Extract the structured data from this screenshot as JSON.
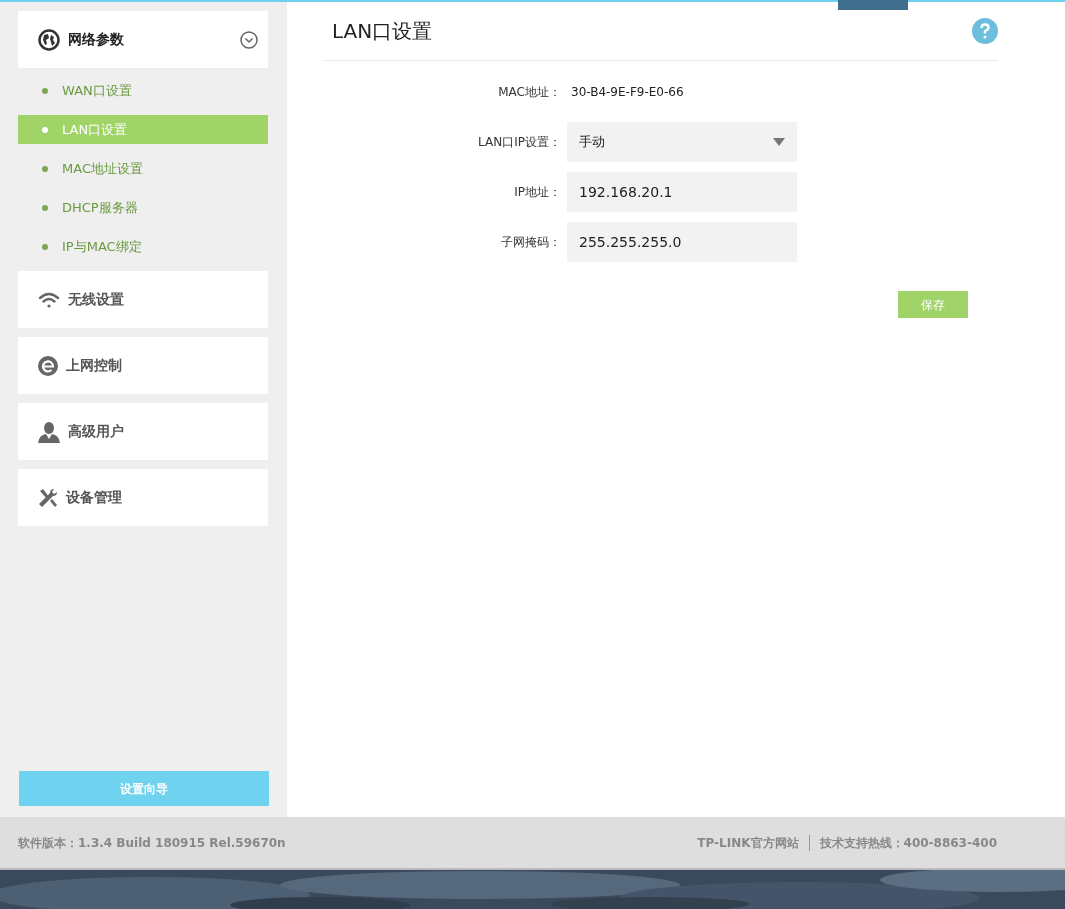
{
  "sidebar": {
    "groups": [
      {
        "label": "网络参数",
        "expanded": true,
        "items": [
          {
            "label": "WAN口设置",
            "selected": false
          },
          {
            "label": "LAN口设置",
            "selected": true
          },
          {
            "label": "MAC地址设置",
            "selected": false
          },
          {
            "label": "DHCP服务器",
            "selected": false
          },
          {
            "label": "IP与MAC绑定",
            "selected": false
          }
        ]
      },
      {
        "label": "无线设置",
        "expanded": false
      },
      {
        "label": "上网控制",
        "expanded": false
      },
      {
        "label": "高级用户",
        "expanded": false
      },
      {
        "label": "设备管理",
        "expanded": false
      }
    ],
    "wizard_button": "设置向导"
  },
  "page": {
    "title": "LAN口设置",
    "fields": [
      {
        "kind": "text",
        "label": "MAC地址：",
        "value": "30-B4-9E-F9-E0-66"
      },
      {
        "kind": "select",
        "label": "LAN口IP设置：",
        "value": "手动"
      },
      {
        "kind": "input",
        "label": "IP地址：",
        "value": "192.168.20.1"
      },
      {
        "kind": "input",
        "label": "子网掩码：",
        "value": "255.255.255.0"
      }
    ],
    "save_button": "保存"
  },
  "footer": {
    "version": "软件版本：1.3.4 Build 180915 Rel.59670n",
    "links": [
      "TP-LINK官方网站",
      "技术支持热线：400-8863-400"
    ]
  }
}
